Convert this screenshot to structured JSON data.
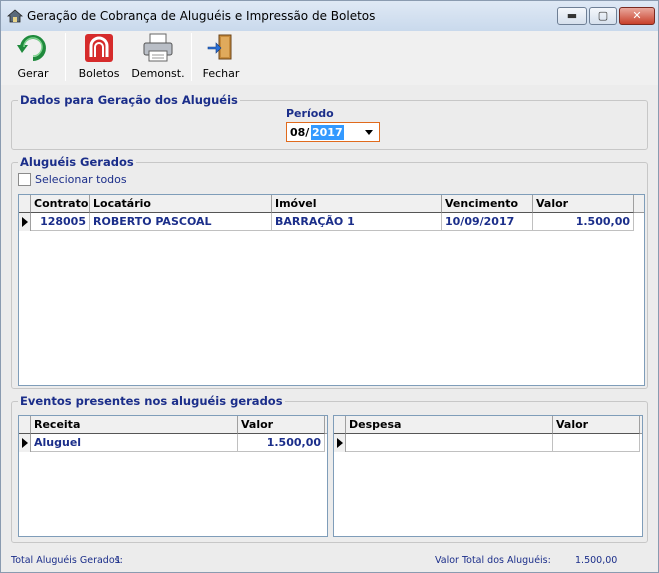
{
  "window": {
    "title": "Geração de Cobrança de Aluguéis e Impressão de Boletos",
    "min_label": "▬",
    "max_label": "▢",
    "close_label": "✕"
  },
  "toolbar": {
    "gerar": "Gerar",
    "boletos": "Boletos",
    "demonst": "Demonst.",
    "fechar": "Fechar"
  },
  "dados": {
    "group_title": "Dados para Geração dos Aluguéis",
    "periodo_label": "Período",
    "periodo_month": "08/",
    "periodo_year": "2017"
  },
  "alugueis": {
    "group_title": "Aluguéis Gerados",
    "select_all": "Selecionar todos",
    "columns": [
      "Contrato",
      "Locatário",
      "Imóvel",
      "Vencimento",
      "Valor"
    ],
    "rows": [
      {
        "contrato": "128005",
        "locatario": "ROBERTO PASCOAL",
        "imovel": "BARRAÇÃO 1",
        "vencimento": "10/09/2017",
        "valor": "1.500,00"
      }
    ]
  },
  "eventos": {
    "group_title": "Eventos presentes nos aluguéis gerados",
    "receita_columns": [
      "Receita",
      "Valor"
    ],
    "receita_rows": [
      {
        "receita": "Aluguel",
        "valor": "1.500,00"
      }
    ],
    "despesa_columns": [
      "Despesa",
      "Valor"
    ]
  },
  "footer": {
    "total_label": "Total Aluguéis Gerados:",
    "total_value": "1",
    "valor_label": "Valor Total dos Aluguéis:",
    "valor_value": "1.500,00"
  },
  "colors": {
    "label_blue": "#1b2e8a",
    "selection": "#3399ff",
    "close_red": "#c8402b"
  }
}
